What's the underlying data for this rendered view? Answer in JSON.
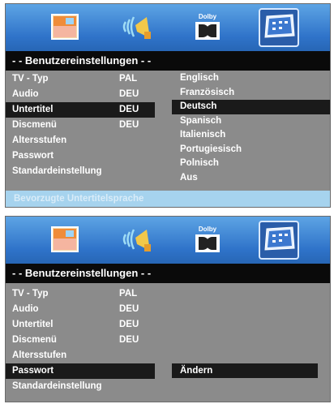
{
  "icons": [
    {
      "name": "picture-icon"
    },
    {
      "name": "audio-icon"
    },
    {
      "name": "dolby-icon",
      "label": "Dolby"
    },
    {
      "name": "settings-icon"
    }
  ],
  "screen1": {
    "title": "- - Benutzereinstellungen - -",
    "items": [
      {
        "label": "TV - Typ",
        "value": "PAL"
      },
      {
        "label": "Audio",
        "value": "DEU"
      },
      {
        "label": "Untertitel",
        "value": "DEU"
      },
      {
        "label": "Discmenü",
        "value": "DEU"
      },
      {
        "label": "Altersstufen",
        "value": ""
      },
      {
        "label": "Passwort",
        "value": ""
      },
      {
        "label": "Standardeinstellung",
        "value": ""
      }
    ],
    "options": [
      "Englisch",
      "Französisch",
      "Deutsch",
      "Spanisch",
      "Italienisch",
      "Portugiesisch",
      "Polnisch",
      "Aus"
    ],
    "status": "Bevorzugte Untertitelsprache"
  },
  "screen2": {
    "title": "- - Benutzereinstellungen - -",
    "items": [
      {
        "label": "TV - Typ",
        "value": "PAL"
      },
      {
        "label": "Audio",
        "value": "DEU"
      },
      {
        "label": "Untertitel",
        "value": "DEU"
      },
      {
        "label": "Discmenü",
        "value": "DEU"
      },
      {
        "label": "Altersstufen",
        "value": ""
      },
      {
        "label": "Passwort",
        "value": ""
      },
      {
        "label": "Standardeinstellung",
        "value": ""
      }
    ],
    "change_label": "Ändern"
  }
}
